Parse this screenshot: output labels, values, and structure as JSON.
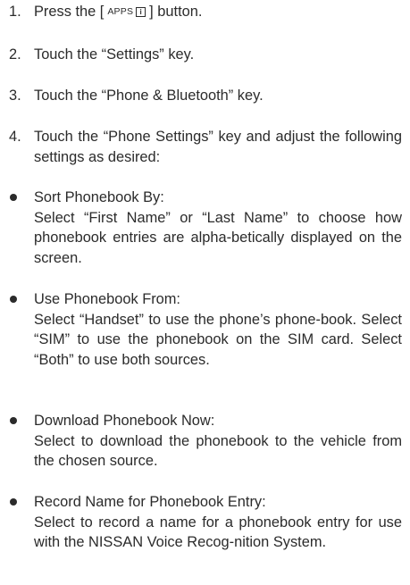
{
  "steps": [
    {
      "num": "1.",
      "text_before": "Press the [",
      "key_label": "APPS",
      "key_icon": "i",
      "text_after": "] button."
    },
    {
      "num": "2.",
      "text": "Touch the “Settings” key."
    },
    {
      "num": "3.",
      "text": "Touch the “Phone & Bluetooth” key."
    },
    {
      "num": "4.",
      "text": "Touch the “Phone Settings” key and adjust the following settings as desired:"
    }
  ],
  "bullets": [
    {
      "title": "Sort Phonebook By:",
      "desc": "Select “First Name” or “Last Name” to choose how phonebook entries are alpha-betically displayed on the screen."
    },
    {
      "title": "Use Phonebook From:",
      "desc": "Select “Handset” to use the phone’s phone-book. Select “SIM” to use the phonebook on the SIM card. Select “Both” to use both sources."
    },
    {
      "title": "Download Phonebook Now:",
      "desc": "Select to download the phonebook to the vehicle from the chosen source."
    },
    {
      "title": "Record Name for Phonebook Entry:",
      "desc": "Select to record a name for a phonebook entry for use with the NISSAN Voice Recog-nition System."
    }
  ]
}
